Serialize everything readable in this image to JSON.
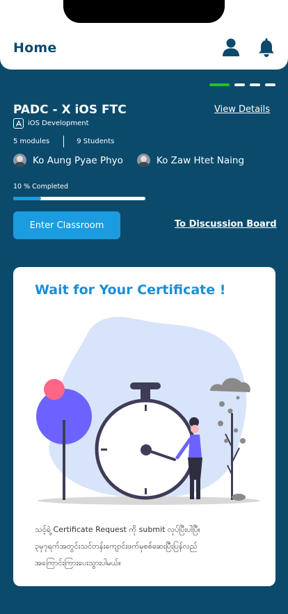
{
  "header": {
    "title": "Home",
    "icons": [
      "profile-icon",
      "bell-icon"
    ]
  },
  "pager": {
    "count": 4,
    "active_index": 0,
    "active_color": "#1ec41e"
  },
  "course": {
    "title": "PADC - X iOS FTC",
    "view_details": "View Details",
    "category": "iOS Development",
    "modules": "5 modules",
    "students": "9 Students",
    "instructors": [
      {
        "name": "Ko Aung Pyae Phyo"
      },
      {
        "name": "Ko Zaw Htet Naing"
      }
    ],
    "progress_label": "10 % Completed",
    "progress_fraction": 0.1,
    "enter_button": "Enter Classroom",
    "discussion_link": "To Discussion Board"
  },
  "certificate": {
    "title": "Wait for Your Certificate !",
    "lines": [
      "သင့်ရဲ့ Certificate Request ကို submit လုပ်ပြီးပါပြီ။",
      "၃မှ၇ရက်အတွင်းသင်တန်းကျောင်းဖက်မှစစ်ဆေးပြီးပြန်လည်",
      "အကြောင်းကြားပေးသွားပါမယ်။"
    ]
  },
  "colors": {
    "background": "#0b4a6b",
    "accent": "#1b9be0",
    "card_title": "#1b8ed6"
  }
}
